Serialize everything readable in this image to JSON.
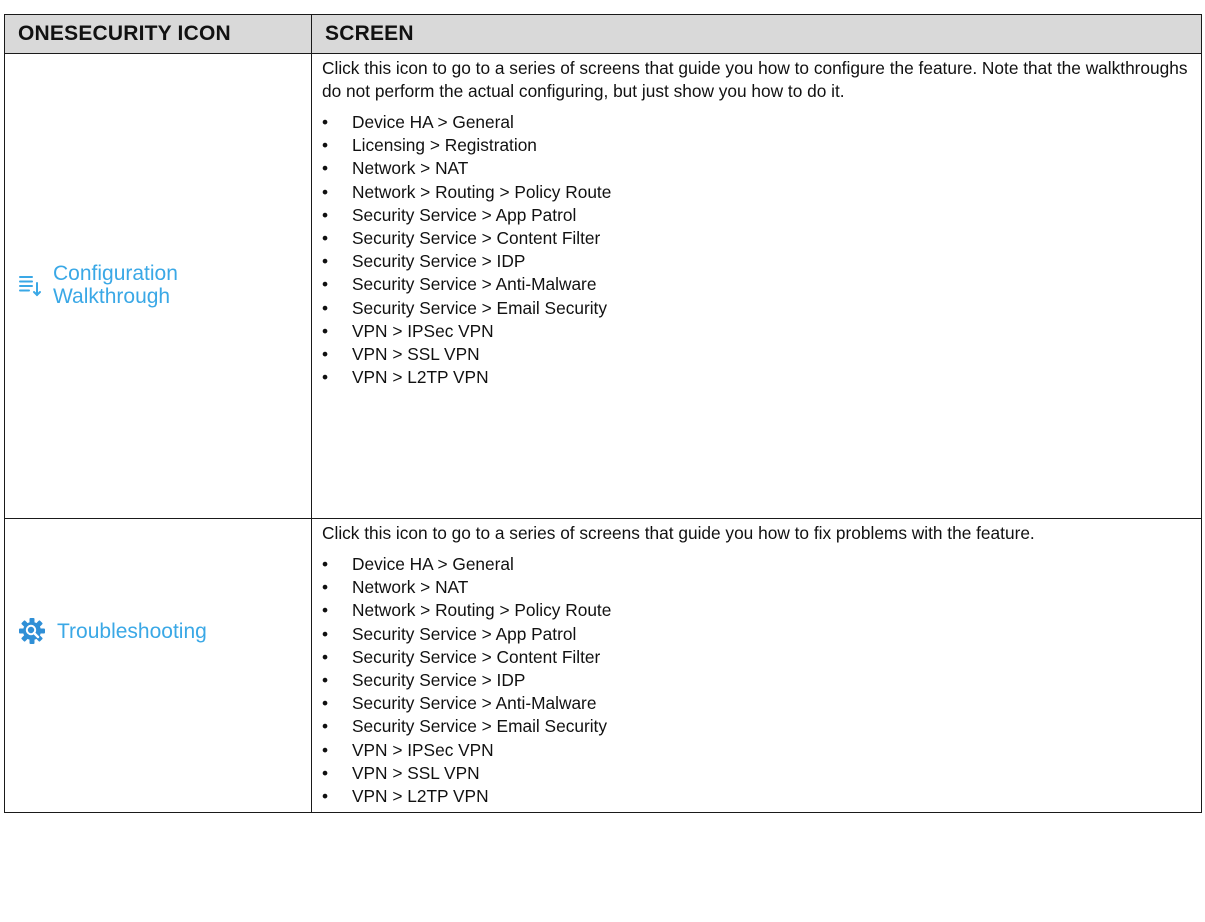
{
  "table": {
    "headers": [
      "ONESECURITY ICON",
      "SCREEN"
    ],
    "rows": [
      {
        "icon_name": "walkthrough-icon",
        "icon_label_line1": "Configuration",
        "icon_label_line2": "Walkthrough",
        "description": "Click this icon to go to a series of screens that guide you how to configure the feature. Note that the walkthroughs do not perform the actual configuring, but just show you how to do it.",
        "items": [
          "Device HA > General",
          "Licensing > Registration",
          "Network > NAT",
          "Network > Routing > Policy Route",
          "Security Service > App Patrol",
          "Security Service > Content Filter",
          "Security Service > IDP",
          "Security Service > Anti-Malware",
          "Security Service > Email Security",
          "VPN > IPSec VPN",
          "VPN > SSL VPN",
          "VPN > L2TP VPN"
        ]
      },
      {
        "icon_name": "troubleshooting-gear-icon",
        "icon_label_line1": "Troubleshooting",
        "description": "Click this icon to go to a series of screens that guide you how to fix problems with the feature.",
        "items": [
          "Device HA > General",
          "Network > NAT",
          "Network > Routing > Policy Route",
          "Security Service > App Patrol",
          "Security Service > Content Filter",
          "Security Service > IDP",
          "Security Service > Anti-Malware",
          "Security Service > Email Security",
          "VPN > IPSec VPN",
          "VPN > SSL VPN",
          "VPN > L2TP VPN"
        ]
      }
    ]
  },
  "colors": {
    "header_bg": "#d9d9d9",
    "icon_blue": "#3aa8e6",
    "border": "#1a1a1a"
  },
  "bullet_glyph": "•"
}
